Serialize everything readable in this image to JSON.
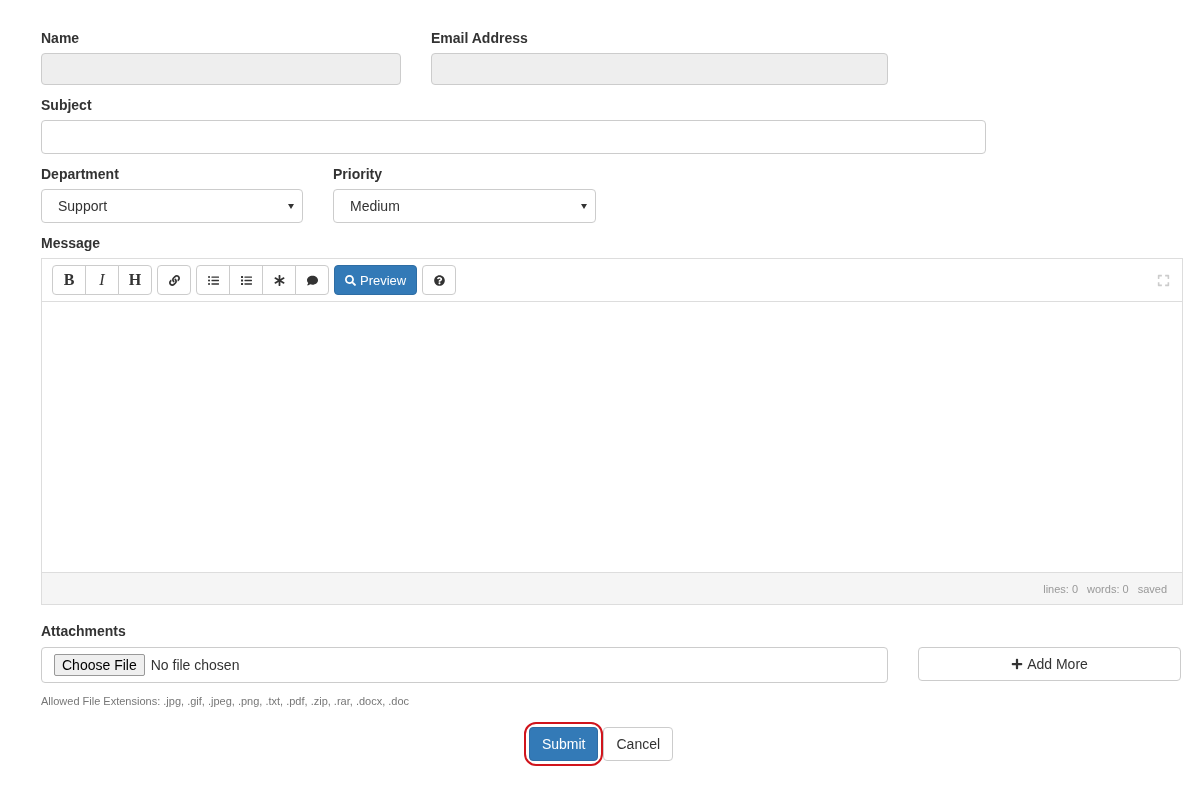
{
  "name": {
    "label": "Name",
    "disabled": true
  },
  "email": {
    "label": "Email Address",
    "disabled": true
  },
  "subject": {
    "label": "Subject"
  },
  "department": {
    "label": "Department",
    "value": "Support"
  },
  "priority": {
    "label": "Priority",
    "value": "Medium"
  },
  "message": {
    "label": "Message",
    "toolbar_text": [
      "B",
      "I",
      "H"
    ],
    "preview": "Preview",
    "status": [
      "lines: 0",
      "words: 0",
      "saved"
    ]
  },
  "attachments": {
    "label": "Attachments",
    "choose": "Choose File",
    "file_status": "No file chosen",
    "add_more": "Add More",
    "note": "Allowed File Extensions: .jpg, .gif, .jpeg, .png, .txt, .pdf, .zip, .rar, .docx, .doc"
  },
  "actions": [
    {
      "label": "Submit",
      "kind": "primary",
      "highlighted": true
    },
    {
      "label": "Cancel",
      "kind": "default",
      "highlighted": false
    }
  ]
}
